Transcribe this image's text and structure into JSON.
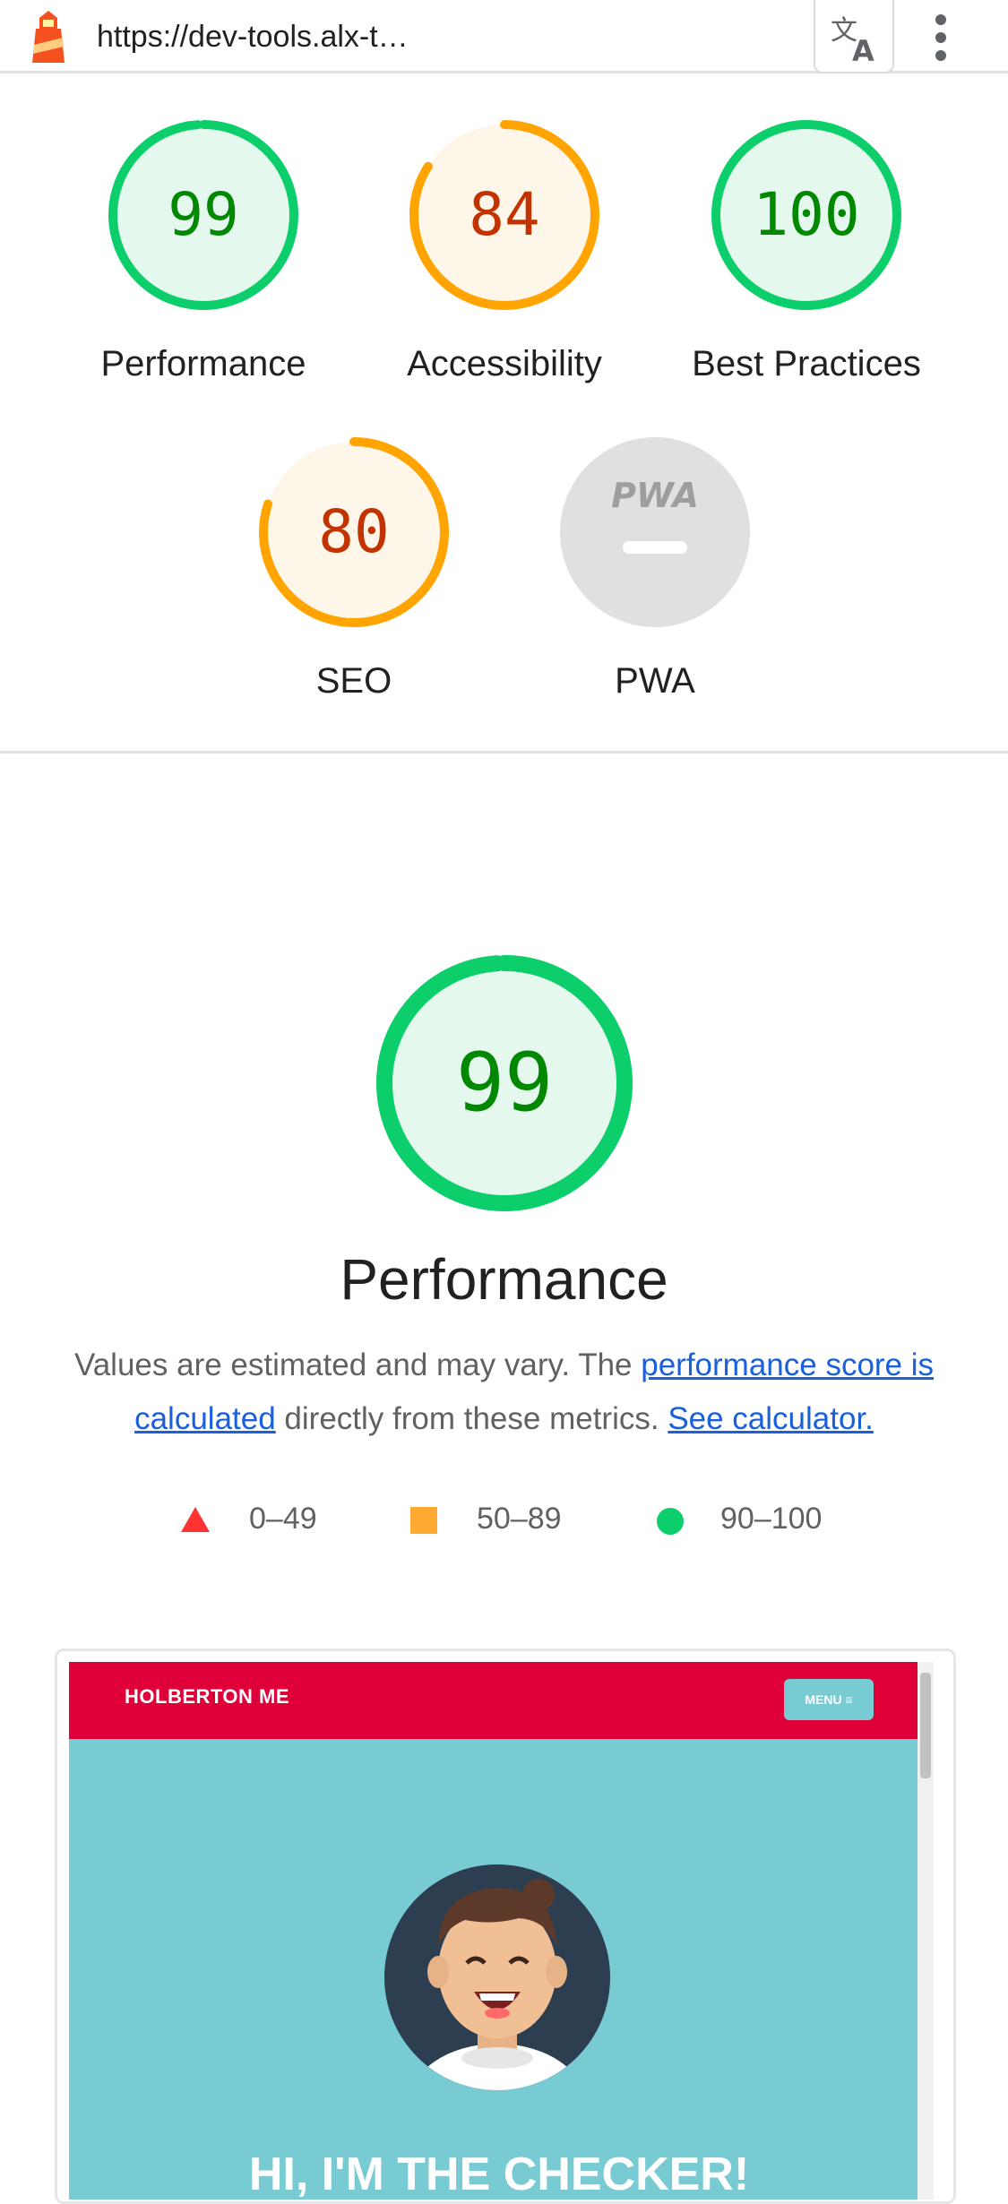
{
  "browser": {
    "url": "https://dev-tools.alx-t…"
  },
  "summary_gauges": [
    {
      "label": "Performance",
      "score": "99",
      "rating": "pass",
      "value": 99
    },
    {
      "label": "Accessibility",
      "score": "84",
      "rating": "average",
      "value": 84
    },
    {
      "label": "Best Practices",
      "score": "100",
      "rating": "pass",
      "value": 100
    },
    {
      "label": "SEO",
      "score": "80",
      "rating": "average",
      "value": 80
    },
    {
      "label": "PWA",
      "score": "",
      "rating": "na",
      "badge": "PWA"
    }
  ],
  "performance": {
    "score": "99",
    "value": 99,
    "title": "Performance",
    "desc_text_1": "Values are estimated and may vary. The ",
    "desc_link_1": "performance score is calculated",
    "desc_text_2": " directly from these metrics. ",
    "desc_link_2": "See calculator."
  },
  "legend": [
    {
      "range": "0–49",
      "icon": "triangle-icon",
      "color": "#ff3333"
    },
    {
      "range": "50–89",
      "icon": "square-icon",
      "color": "#ffaa33"
    },
    {
      "range": "90–100",
      "icon": "circle-icon",
      "color": "#0cce6b"
    }
  ],
  "preview": {
    "brand": "HOLBERTON ME",
    "menu": "MENU ≡",
    "heading": "HI, I'M THE CHECKER!"
  },
  "colors": {
    "pass": "#0cce6b",
    "average": "#ffa400",
    "fail": "#ff3333",
    "na": "#e0e0e0",
    "header_red": "#e00039",
    "hero_teal": "#78cbd2"
  }
}
